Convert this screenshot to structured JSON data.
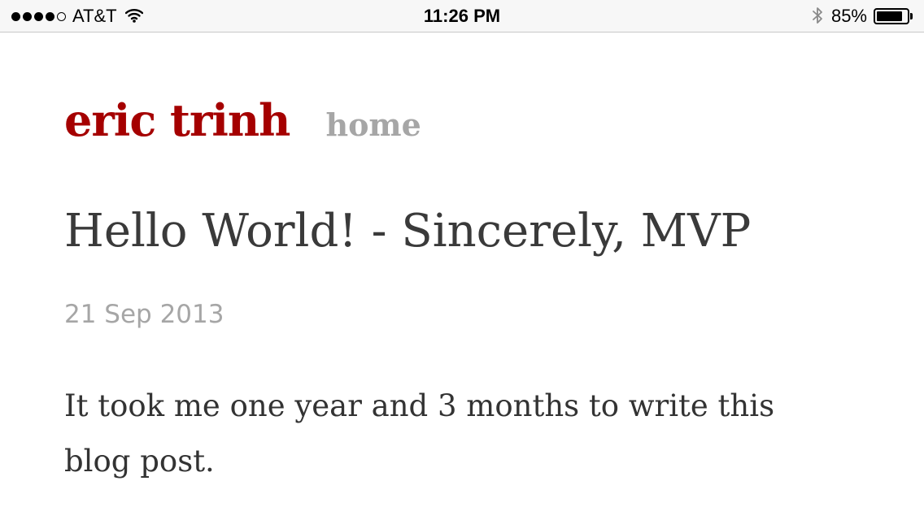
{
  "status_bar": {
    "signal_bars_filled": 4,
    "signal_bars_total": 5,
    "carrier": "AT&T",
    "time": "11:26 PM",
    "battery_percent_label": "85%",
    "battery_level": 0.85
  },
  "site": {
    "title": "eric trinh",
    "nav_home": "home"
  },
  "post": {
    "title": "Hello World! - Sincerely, MVP",
    "date": "21 Sep 2013",
    "body": "It took me one year and 3 months to write this blog post."
  },
  "colors": {
    "brand": "#a50000",
    "muted": "#a6a6a6",
    "text": "#333333"
  }
}
